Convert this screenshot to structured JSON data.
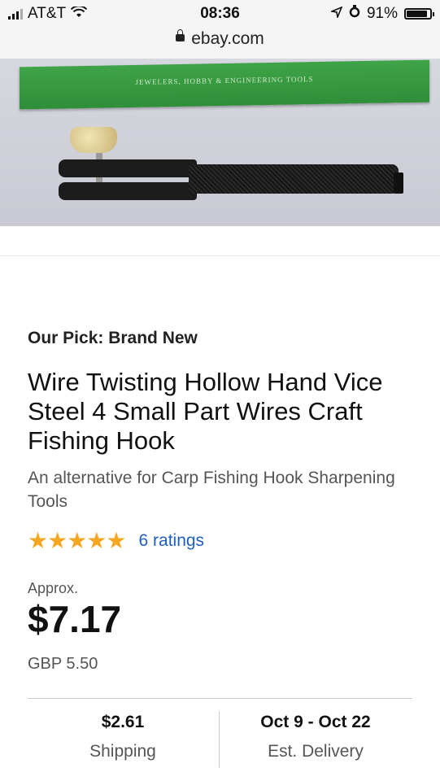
{
  "status_bar": {
    "carrier": "AT&T",
    "time": "08:36",
    "battery": "91%",
    "battery_level": 0.91,
    "url": "ebay.com"
  },
  "product_image": {
    "box_text": "JEWELERS, HOBBY & ENGINEERING TOOLS"
  },
  "listing": {
    "pick_label": "Our Pick: Brand New",
    "title": "Wire Twisting Hollow Hand Vice Steel 4 Small Part Wires Craft Fishing Hook",
    "subtitle": "An alternative for Carp Fishing Hook Sharpening Tools",
    "stars": "★★★★★",
    "rating_value": 5,
    "ratings_text": "6 ratings",
    "approx_label": "Approx.",
    "price": "$7.17",
    "gbp": "GBP 5.50"
  },
  "details": {
    "shipping_value": "$2.61",
    "shipping_label": "Shipping",
    "delivery_value": "Oct 9 - Oct 22",
    "delivery_label": "Est. Delivery"
  },
  "colors": {
    "star": "#f5a623",
    "link": "#1f5fc2"
  }
}
